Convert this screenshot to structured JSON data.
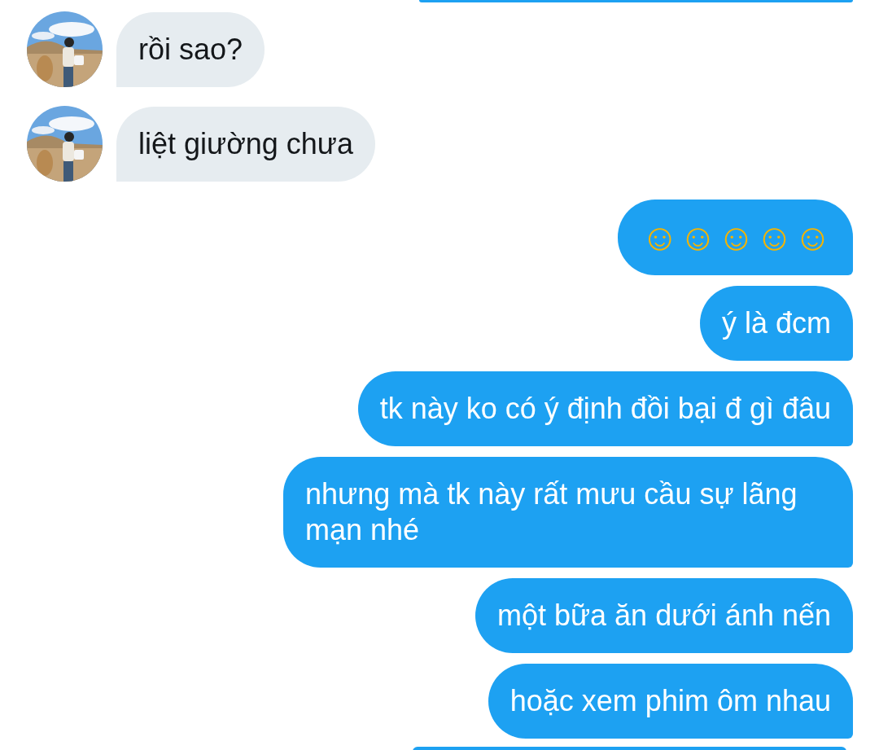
{
  "messages": [
    {
      "outgoing": true,
      "kind": "clipped"
    },
    {
      "outgoing": false,
      "kind": "text",
      "text": "rồi sao?"
    },
    {
      "outgoing": false,
      "kind": "text",
      "text": "liệt giường chưa"
    },
    {
      "outgoing": true,
      "kind": "emoji",
      "text": "☺☺☺☺☺"
    },
    {
      "outgoing": true,
      "kind": "text",
      "text": "ý là đcm"
    },
    {
      "outgoing": true,
      "kind": "text",
      "text": "tk này ko có ý định đồi bại đ gì đâu"
    },
    {
      "outgoing": true,
      "kind": "text",
      "text": "nhưng mà tk này rất mưu cầu sự lãng mạn nhé"
    },
    {
      "outgoing": true,
      "kind": "text",
      "text": "một bữa ăn dưới ánh nến"
    },
    {
      "outgoing": true,
      "kind": "text",
      "text": "hoặc xem phim ôm nhau"
    },
    {
      "outgoing": true,
      "kind": "clipped"
    }
  ]
}
